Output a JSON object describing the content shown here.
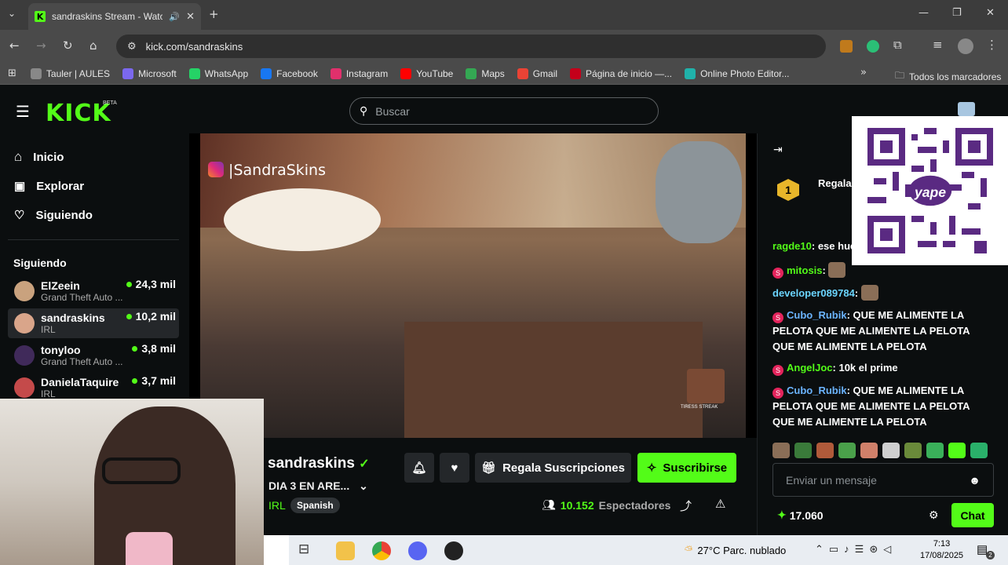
{
  "browser": {
    "tab_title": "sandraskins Stream - Watch",
    "url": "kick.com/sandraskins",
    "bookmarks": [
      {
        "label": "Tauler | AULES",
        "color": "#888"
      },
      {
        "label": "Microsoft",
        "color": "#7b68ee"
      },
      {
        "label": "WhatsApp",
        "color": "#25d366"
      },
      {
        "label": "Facebook",
        "color": "#1877f2"
      },
      {
        "label": "Instagram",
        "color": "#e1306c"
      },
      {
        "label": "YouTube",
        "color": "#ff0000"
      },
      {
        "label": "Maps",
        "color": "#34a853"
      },
      {
        "label": "Gmail",
        "color": "#ea4335"
      },
      {
        "label": "Página de inicio —...",
        "color": "#c4001a"
      },
      {
        "label": "Online Photo Editor...",
        "color": "#20b2aa"
      }
    ],
    "all_bookmarks": "Todos los marcadores"
  },
  "site": {
    "logo": "KICK",
    "beta": "BETA",
    "search_placeholder": "Buscar"
  },
  "sidebar": {
    "nav": [
      {
        "label": "Inicio",
        "icon": "home-icon"
      },
      {
        "label": "Explorar",
        "icon": "compass-icon"
      },
      {
        "label": "Siguiendo",
        "icon": "heart-icon"
      }
    ],
    "following_title": "Siguiendo",
    "channels": [
      {
        "name": "ElZeein",
        "game": "Grand Theft Auto ...",
        "viewers": "24,3 mil",
        "color": "#c9a27e"
      },
      {
        "name": "sandraskins",
        "game": "IRL",
        "viewers": "10,2 mil",
        "color": "#d9a58a"
      },
      {
        "name": "tonyloo",
        "game": "Grand Theft Auto ...",
        "viewers": "3,8 mil",
        "color": "#402a5a"
      },
      {
        "name": "DanielaTaquire",
        "game": "IRL",
        "viewers": "3,7 mil",
        "color": "#c44a4a"
      }
    ]
  },
  "video": {
    "watermark": "|SandraSkins",
    "corner_label": "TIRESS STREAK"
  },
  "stream": {
    "channel_name": "sandraskins",
    "title": "DIA 3 EN ARE...",
    "category": "IRL",
    "language": "Spanish",
    "gift_label": "Regala Suscripciones",
    "subscribe_label": "Suscribirse",
    "viewer_count": "10.152",
    "viewer_label": "Espectadores"
  },
  "chat": {
    "pinned_rank": "1",
    "pinned_text": "Regala",
    "messages": [
      {
        "user": "ragde10",
        "user_color": "#53fc18",
        "text": "ese hue",
        "badge": false
      },
      {
        "user": "mitosis",
        "user_color": "#53fc18",
        "text": "",
        "badge": true
      },
      {
        "user": "developer089784",
        "user_color": "#6bd5ff",
        "text": "",
        "badge": false
      },
      {
        "user": "Cubo_Rubik",
        "user_color": "#6bb4ff",
        "text": "QUE ME ALIMENTE LA PELOTA  QUE ME ALIMENTE LA PELOTA  QUE ME ALIMENTE LA PELOTA",
        "badge": true
      },
      {
        "user": "AngelJoc",
        "user_color": "#53fc18",
        "text": "10k el prime",
        "badge": true
      },
      {
        "user": "Cubo_Rubik",
        "user_color": "#6bb4ff",
        "text": "QUE ME ALIMENTE LA PELOTA  QUE ME ALIMENTE LA PELOTA  QUE ME ALIMENTE LA PELOTA",
        "badge": true
      }
    ],
    "input_placeholder": "Enviar un mensaje",
    "points": "17.060",
    "send_label": "Chat"
  },
  "taskbar": {
    "weather": "27°C  Parc. nublado",
    "time": "7:13",
    "date": "17/08/2025",
    "notifications": "2"
  }
}
